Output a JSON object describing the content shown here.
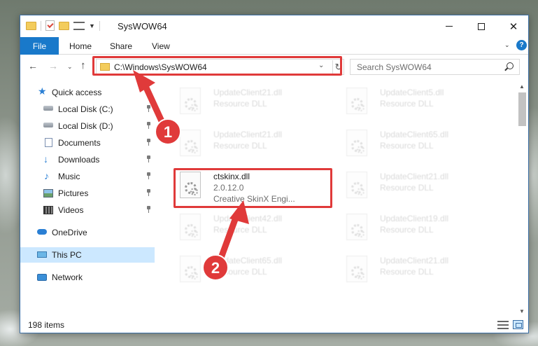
{
  "window": {
    "title": "SysWOW64",
    "accent_color": "#1979ca"
  },
  "ribbon": {
    "file_label": "File",
    "home_label": "Home",
    "share_label": "Share",
    "view_label": "View",
    "help_glyph": "?"
  },
  "nav": {
    "address_path": "C:\\Windows\\SysWOW64",
    "search_placeholder": "Search SysWOW64"
  },
  "sidebar": {
    "items": [
      {
        "label": "Quick access",
        "icon": "star-icon"
      },
      {
        "label": "Local Disk (C:)",
        "icon": "drive-icon",
        "pinned": true
      },
      {
        "label": "Local Disk (D:)",
        "icon": "drive-icon",
        "pinned": true
      },
      {
        "label": "Documents",
        "icon": "documents-icon",
        "pinned": true
      },
      {
        "label": "Downloads",
        "icon": "download-icon",
        "pinned": true
      },
      {
        "label": "Music",
        "icon": "music-icon",
        "pinned": true
      },
      {
        "label": "Pictures",
        "icon": "pictures-icon",
        "pinned": true
      },
      {
        "label": "Videos",
        "icon": "videos-icon",
        "pinned": true
      },
      {
        "label": "OneDrive",
        "icon": "cloud-icon"
      },
      {
        "label": "This PC",
        "icon": "computer-icon",
        "selected": true
      },
      {
        "label": "Network",
        "icon": "network-icon"
      }
    ]
  },
  "files": [
    {
      "name": "UpdateClient21.dll",
      "desc": "Resource DLL"
    },
    {
      "name": "UpdateClient5.dll",
      "desc": "Resource DLL"
    },
    {
      "name": "UpdateClient21.dll",
      "desc": "Resource DLL"
    },
    {
      "name": "UpdateClient65.dll",
      "desc": "Resource DLL"
    },
    {
      "name": "ctskinx.dll",
      "version": "2.0.12.0",
      "desc": "Creative SkinX Engi..."
    },
    {
      "name": "UpdateClient21.dll",
      "desc": "Resource DLL"
    },
    {
      "name": "UpdateClient42.dll",
      "desc": "Resource DLL"
    },
    {
      "name": "UpdateClient19.dll",
      "desc": "Resource DLL"
    },
    {
      "name": "UpdateClient65.dll",
      "desc": "Resource DLL"
    },
    {
      "name": "UpdateClient21.dll",
      "desc": "Resource DLL"
    }
  ],
  "status": {
    "item_count": "198 items"
  },
  "annotations": {
    "step1": "1",
    "step2": "2",
    "highlight_color": "#e03a3a"
  }
}
